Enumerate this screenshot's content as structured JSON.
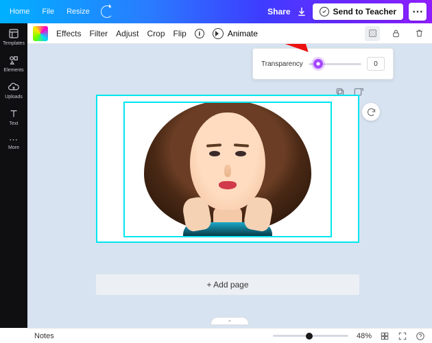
{
  "topbar": {
    "home": "Home",
    "file": "File",
    "resize": "Resize",
    "share": "Share",
    "send": "Send to Teacher"
  },
  "rail": {
    "templates": "Templates",
    "elements": "Elements",
    "uploads": "Uploads",
    "text": "Text",
    "more": "More"
  },
  "toolbar": {
    "effects": "Effects",
    "filter": "Filter",
    "adjust": "Adjust",
    "crop": "Crop",
    "flip": "Flip",
    "animate": "Animate"
  },
  "transparency": {
    "label": "Transparency",
    "value": "0",
    "thumb_pct": 18
  },
  "add_page": "+ Add page",
  "status": {
    "notes": "Notes",
    "zoom_label": "48%",
    "zoom_pct": 48
  }
}
